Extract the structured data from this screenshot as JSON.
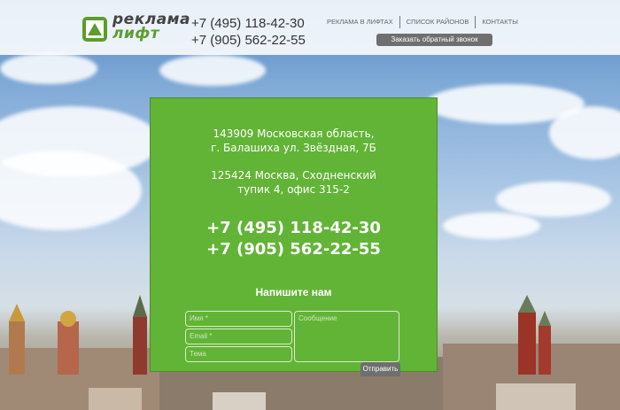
{
  "header": {
    "logo_line1": "реклама",
    "logo_line2": "лифт",
    "phone1": "+7 (495) 118-42-30",
    "phone2": "+7 (905) 562-22-55",
    "nav": [
      "РЕКЛАМА В ЛИФТАХ",
      "СПИСОК РАЙОНОВ",
      "КОНТАКТЫ"
    ],
    "callback_label": "Заказать обратный звонок"
  },
  "contacts": {
    "address1_line1": "143909 Московская область,",
    "address1_line2": "г. Балашиха  ул. Звёздная, 7Б",
    "address2_line1": "125424  Москва, Сходненский",
    "address2_line2": "тупик 4, офис  315-2",
    "phone1": "+7 (495) 118-42-30",
    "phone2": "+7 (905) 562-22-55"
  },
  "form": {
    "title": "Напишите нам",
    "name_placeholder": "Имя *",
    "email_placeholder": "Email *",
    "subject_placeholder": "Тема",
    "message_placeholder": "Сообщение",
    "send_label": "Отправить"
  },
  "colors": {
    "green": "#62b436",
    "button_gray": "#6f6f6f"
  }
}
